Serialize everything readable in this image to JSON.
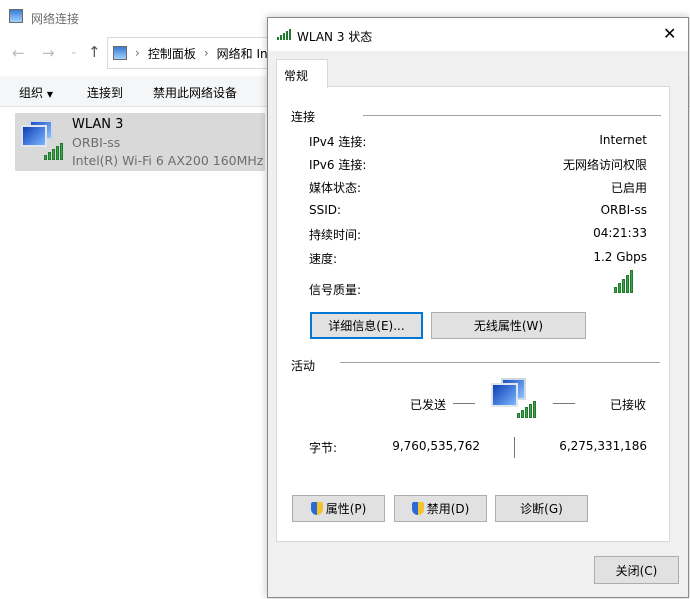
{
  "explorer": {
    "title": "网络连接",
    "breadcrumb": [
      "控制面板",
      "网络和 In"
    ],
    "toolbar": {
      "organize": "组织",
      "connect": "连接到",
      "disable": "禁用此网络设备"
    },
    "item": {
      "name": "WLAN 3",
      "network": "ORBI-ss",
      "adapter": "Intel(R) Wi-Fi 6 AX200 160MHz"
    }
  },
  "dialog": {
    "title": "WLAN 3 状态",
    "tab": "常规",
    "connection": {
      "heading": "连接",
      "rows": [
        {
          "label": "IPv4 连接:",
          "value": "Internet"
        },
        {
          "label": "IPv6 连接:",
          "value": "无网络访问权限"
        },
        {
          "label": "媒体状态:",
          "value": "已启用"
        },
        {
          "label": "SSID:",
          "value": "ORBI-ss"
        },
        {
          "label": "持续时间:",
          "value": "04:21:33"
        },
        {
          "label": "速度:",
          "value": "1.2 Gbps"
        }
      ],
      "signal_label": "信号质量:",
      "signal_bars": 5,
      "details_button": "详细信息(E)...",
      "wireless_button": "无线属性(W)"
    },
    "activity": {
      "heading": "活动",
      "sent": "已发送",
      "received": "已接收",
      "bytes_label": "字节:",
      "bytes_sent": "9,760,535,762",
      "bytes_received": "6,275,331,186"
    },
    "buttons": {
      "properties": "属性(P)",
      "disable": "禁用(D)",
      "diagnose": "诊断(G)",
      "close": "关闭(C)"
    }
  }
}
